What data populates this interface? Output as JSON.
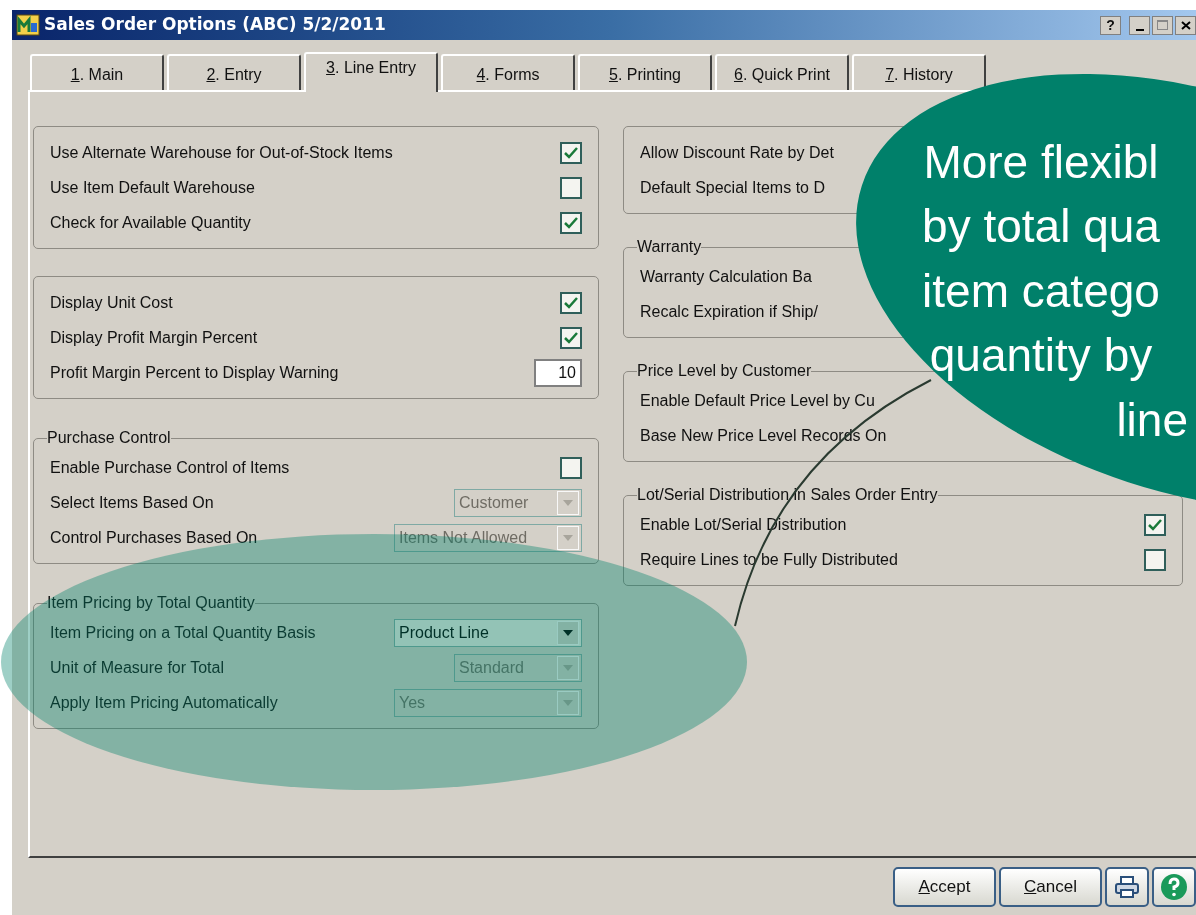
{
  "window": {
    "title": "Sales Order Options (ABC) 5/2/2011",
    "help_glyph": "?"
  },
  "tabs": [
    {
      "label": "1. Main",
      "selected": false
    },
    {
      "label": "2. Entry",
      "selected": false
    },
    {
      "label": "3. Line Entry",
      "selected": true
    },
    {
      "label": "4. Forms",
      "selected": false
    },
    {
      "label": "5. Printing",
      "selected": false
    },
    {
      "label": "6. Quick Print",
      "selected": false
    },
    {
      "label": "7. History",
      "selected": false
    }
  ],
  "left_groups": [
    {
      "rows": [
        {
          "kind": "checkbox",
          "label": "Use Alternate Warehouse for Out-of-Stock Items",
          "checked": true
        },
        {
          "kind": "checkbox",
          "label": "Use Item Default Warehouse",
          "checked": false
        },
        {
          "kind": "checkbox",
          "label": "Check for Available Quantity",
          "checked": true
        }
      ]
    },
    {
      "rows": [
        {
          "kind": "checkbox",
          "label": "Display Unit Cost",
          "checked": true
        },
        {
          "kind": "checkbox",
          "label": "Display Profit Margin Percent",
          "checked": true
        },
        {
          "kind": "number",
          "label": "Profit Margin Percent to Display Warning",
          "value": "10"
        }
      ]
    },
    {
      "title": "Purchase Control",
      "rows": [
        {
          "kind": "checkbox",
          "label": "Enable Purchase Control of Items",
          "checked": false
        },
        {
          "kind": "select",
          "label": "Select Items Based On",
          "value": "Customer",
          "disabled": true
        },
        {
          "kind": "select",
          "label": "Control Purchases Based On",
          "value": "Items Not Allowed",
          "disabled": true
        }
      ]
    },
    {
      "title": "Item Pricing by Total Quantity",
      "rows": [
        {
          "kind": "select",
          "label": "Item Pricing on a Total Quantity Basis",
          "value": "Product Line",
          "disabled": false
        },
        {
          "kind": "select",
          "label": "Unit of Measure for Total",
          "value": "Standard",
          "disabled": true
        },
        {
          "kind": "select",
          "label": "Apply Item Pricing Automatically",
          "value": "Yes",
          "disabled": true
        }
      ]
    }
  ],
  "right_groups": [
    {
      "rows": [
        {
          "kind": "text",
          "label": "Allow Discount Rate by Det"
        },
        {
          "kind": "text",
          "label": "Default Special Items to D"
        }
      ]
    },
    {
      "title": "Warranty",
      "rows": [
        {
          "kind": "text",
          "label": "Warranty Calculation Ba"
        },
        {
          "kind": "text",
          "label": "Recalc Expiration if Ship/"
        }
      ]
    },
    {
      "title": "Price Level by Customer",
      "rows": [
        {
          "kind": "text",
          "label": "Enable Default Price Level by Cu"
        },
        {
          "kind": "text",
          "label": "Base New Price Level Records On"
        }
      ]
    },
    {
      "title": "Lot/Serial Distribution in Sales Order Entry",
      "rows": [
        {
          "kind": "checkbox",
          "label": "Enable Lot/Serial Distribution",
          "checked": true
        },
        {
          "kind": "checkbox",
          "label": "Require Lines to be Fully Distributed",
          "checked": false
        }
      ]
    }
  ],
  "callout": {
    "lines": [
      "More flexibl",
      "by total qua",
      "item catego",
      "quantity by",
      "line"
    ]
  },
  "buttons": [
    {
      "kind": "text",
      "label": "Accept"
    },
    {
      "kind": "text",
      "label": "Cancel"
    },
    {
      "kind": "print"
    },
    {
      "kind": "help"
    }
  ]
}
